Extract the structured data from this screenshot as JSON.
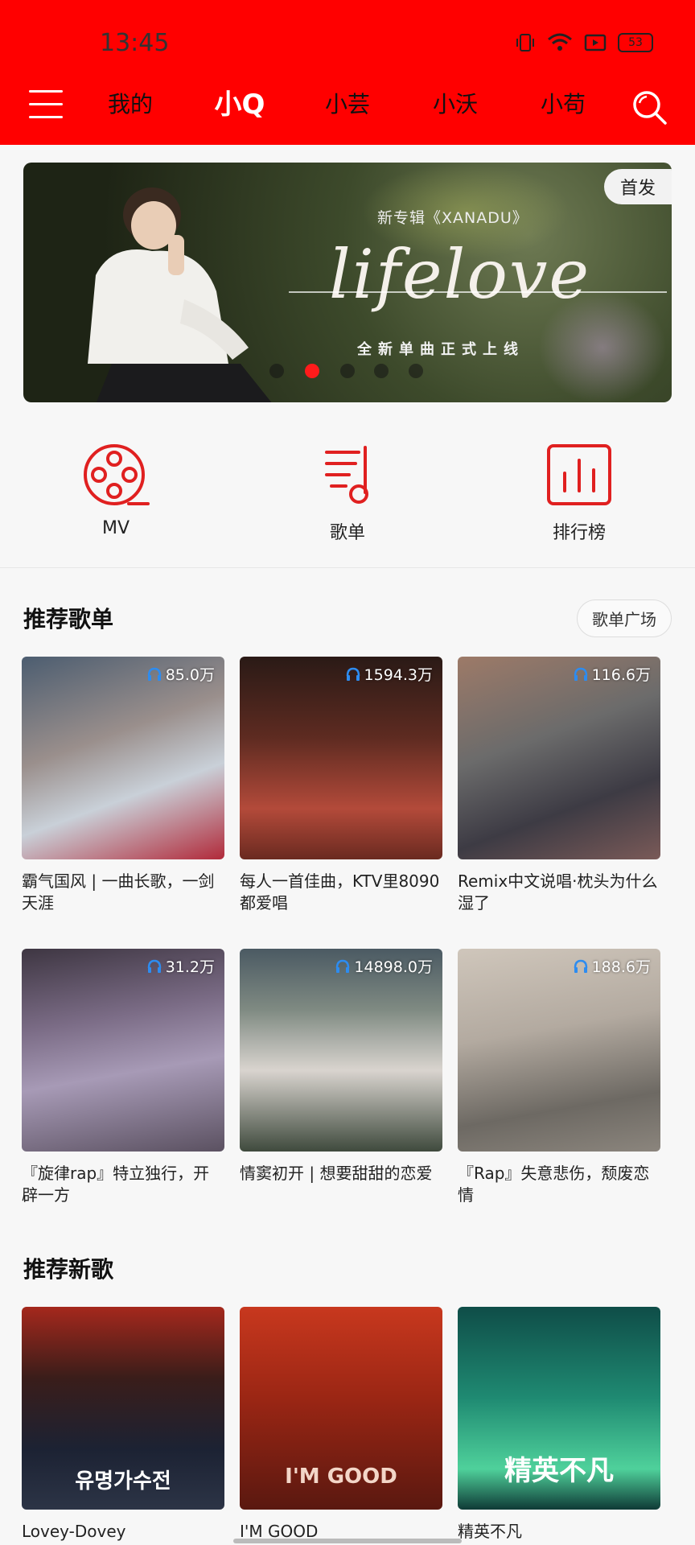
{
  "status_bar": {
    "time": "13:45",
    "battery": "53"
  },
  "nav": {
    "tabs": [
      "我的",
      "小Q",
      "小芸",
      "小沃",
      "小苟"
    ],
    "active_tab": "小Q"
  },
  "banner": {
    "badge": "首发",
    "subtitle": "新专辑《XANADU》",
    "script_title": "lifelove",
    "caption": "全新单曲正式上线",
    "slide_count": 5,
    "active_slide": 1
  },
  "shortcuts": [
    {
      "label": "MV",
      "icon": "film-reel-icon"
    },
    {
      "label": "歌单",
      "icon": "playlist-icon"
    },
    {
      "label": "排行榜",
      "icon": "chart-icon"
    }
  ],
  "recommended_playlists": {
    "title": "推荐歌单",
    "more_button": "歌单广场",
    "items": [
      {
        "plays": "85.0万",
        "title": "霸气国风 | 一曲长歌，一剑天涯"
      },
      {
        "plays": "1594.3万",
        "title": "每人一首佳曲，KTV里8090都爱唱"
      },
      {
        "plays": "116.6万",
        "title": "Remix中文说唱·枕头为什么湿了"
      },
      {
        "plays": "31.2万",
        "title": "『旋律rap』特立独行，开辟一方"
      },
      {
        "plays": "14898.0万",
        "title": "情窦初开 | 想要甜甜的恋爱"
      },
      {
        "plays": "188.6万",
        "title": "『Rap』失意悲伤，颓废恋情"
      }
    ]
  },
  "recommended_songs": {
    "title": "推荐新歌",
    "items": [
      {
        "title": "Lovey-Dovey",
        "cover_text": "유명가수전"
      },
      {
        "title": "I'M GOOD",
        "cover_text": "I'M GOOD"
      },
      {
        "title": "精英不凡",
        "cover_text": "精英不凡"
      }
    ]
  },
  "colors": {
    "header": "#ff0000",
    "accent": "#e02020",
    "background": "#f7f7f7"
  }
}
